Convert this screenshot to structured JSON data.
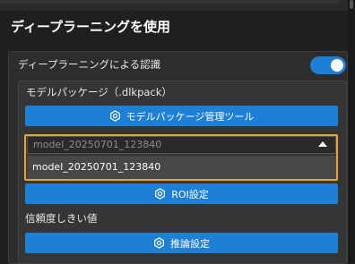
{
  "section": {
    "title": "ディープラーニングを使用"
  },
  "deep_learning_panel": {
    "label": "ディープラーニングによる認識",
    "toggle_on": true
  },
  "package_panel": {
    "label": "モデルパッケージ（.dlkpack）",
    "manage_button": "モデルパッケージ管理ツール",
    "select_value": "model_20250701_123840",
    "dropdown_options": [
      "model_20250701_123840"
    ],
    "roi_button": "ROI設定",
    "confidence_label": "信頼度しきい値",
    "inference_button": "推論設定"
  },
  "colors": {
    "accent": "#1d7fd6",
    "highlight": "#f0a22e",
    "background": "#1f1f1f"
  }
}
